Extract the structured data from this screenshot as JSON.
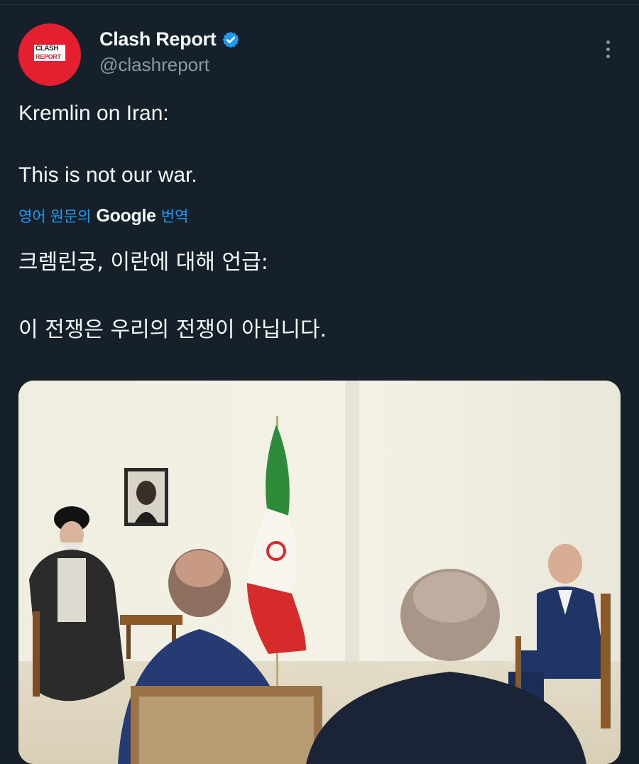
{
  "account": {
    "display_name": "Clash Report",
    "handle": "@clashreport",
    "avatar_top": "CLASH",
    "avatar_bottom": "REPORT",
    "verified_color": "#1d9bf0"
  },
  "tweet": {
    "text_line1": "Kremlin on Iran:",
    "text_line2": "This is not our war.",
    "translate_prefix": "영어 원문의",
    "translate_brand": "Google",
    "translate_suffix": "번역",
    "translated_line1": "크렘린궁, 이란에 대해 언급:",
    "translated_line2": "이 전쟁은 우리의 전쟁이 아닙니다."
  },
  "icons": {
    "more": "more-vertical-icon",
    "verified": "verified-badge-icon"
  },
  "colors": {
    "background": "#15202b",
    "accent": "#1d9bf0",
    "text": "#f7f9f9",
    "muted": "#8b98a5"
  }
}
